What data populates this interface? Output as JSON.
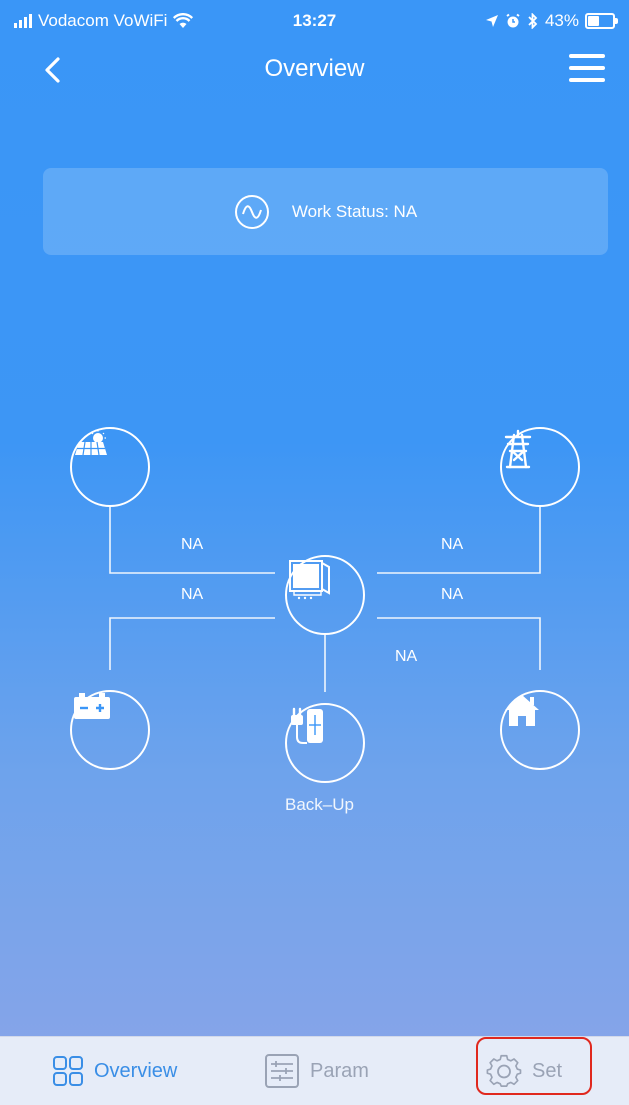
{
  "status_bar": {
    "carrier": "Vodacom VoWiFi",
    "time": "13:27",
    "battery": "43%"
  },
  "nav": {
    "title": "Overview",
    "back_icon": "chevron-left-icon",
    "menu_icon": "hamburger-menu-icon"
  },
  "work_status": {
    "label": "Work Status: NA",
    "icon": "waveform-icon"
  },
  "flows": {
    "pv": "NA",
    "grid": "NA",
    "battery": "NA",
    "load": "NA",
    "backup": "NA"
  },
  "nodes": {
    "pv_icon": "solar-panel-icon",
    "grid_icon": "power-tower-icon",
    "inverter_icon": "inverter-icon",
    "battery_icon": "battery-icon",
    "home_icon": "home-icon",
    "backup_icon": "backup-plug-icon",
    "backup_label": "Back–Up"
  },
  "tabs": [
    {
      "label": "Overview",
      "icon": "grid-icon",
      "active": true
    },
    {
      "label": "Param",
      "icon": "sliders-icon",
      "active": false
    },
    {
      "label": "Set",
      "icon": "gear-icon",
      "active": false
    }
  ],
  "colors": {
    "accent": "#3a8ee6",
    "highlight": "#e0281e"
  }
}
